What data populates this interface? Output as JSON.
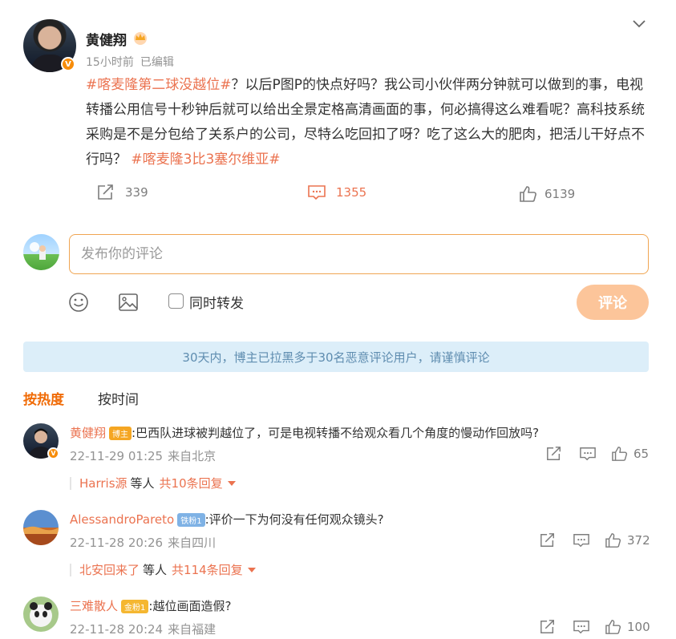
{
  "post": {
    "author": "黄健翔",
    "time": "15小时前",
    "edited": "已编辑",
    "tag1": "#喀麦隆第二球没越位#",
    "body": "？以后P图P的快点好吗？我公司小伙伴两分钟就可以做到的事，电视转播公用信号十秒钟后就可以给出全景定格高清画面的事，何必搞得这么难看呢？高科技系统采购是不是分包给了关系户的公司，尽特么吃回扣了呀？吃了这么大的肥肉，把活儿干好点不行吗？",
    "tag2": "#喀麦隆3比3塞尔维亚#",
    "reposts": "339",
    "comments": "1355",
    "likes": "6139",
    "colors": {
      "accent": "#eb7350",
      "active_tab": "#f06b06"
    }
  },
  "composer": {
    "placeholder": "发布你的评论",
    "repost_label": "同时转发",
    "submit_label": "评论"
  },
  "notice": "30天内，博主已拉黑多于30名恶意评论用户，请谨慎评论",
  "sort_tabs": [
    "按热度",
    "按时间"
  ],
  "comments": [
    {
      "name": "黄健翔",
      "badge": "博主",
      "text": ":巴西队进球被判越位了，可是电视转播不给观众看几个角度的慢动作回放吗?",
      "date": "22-11-29 01:25",
      "location": "来自北京",
      "likes": "65",
      "reply_user": "Harris源",
      "reply_mid": "等人",
      "reply_total": "共10条回复"
    },
    {
      "name": "AlessandroPareto",
      "badge": "铁粉1",
      "text": ":评价一下为何没有任何观众镜头?",
      "date": "22-11-28 20:26",
      "location": "来自四川",
      "likes": "372",
      "reply_user": "北安回来了",
      "reply_mid": "等人",
      "reply_total": "共114条回复"
    },
    {
      "name": "三难散人",
      "badge": "金粉1",
      "text": ":越位画面造假?",
      "date": "22-11-28 20:24",
      "location": "来自福建",
      "likes": "100"
    }
  ]
}
